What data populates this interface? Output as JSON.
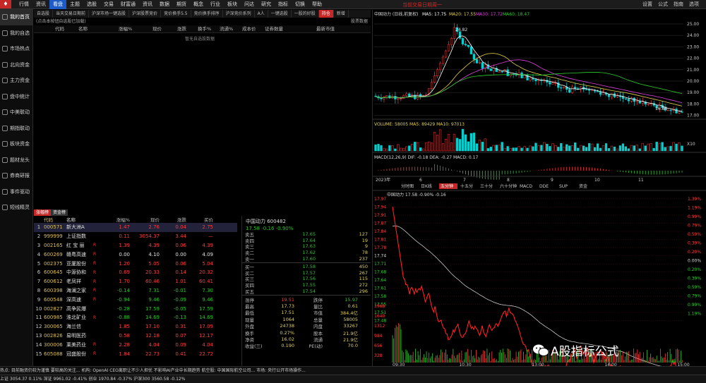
{
  "topbar": {
    "menu": [
      "行情",
      "资讯",
      "看盘",
      "主题",
      "选股",
      "交易",
      "财富通",
      "资讯",
      "数据",
      "期货",
      "概念",
      "行业",
      "板块",
      "问达",
      "研究",
      "指标",
      "切换",
      "帮助"
    ],
    "active_index": 2,
    "center": "当前交易日期周一",
    "right": [
      "设置",
      "公式",
      "指南",
      "选项"
    ]
  },
  "sidebar": {
    "items": [
      "我的首页",
      "我的自选",
      "市场热点",
      "北向资金",
      "主力资金",
      "盘中统计",
      "中美联动",
      "期指联动",
      "板块资金",
      "题材龙头",
      "券商研报",
      "事件驱动",
      "短线精灵"
    ],
    "active_index": 0
  },
  "tabs": [
    "自选股",
    "当天交易日期前",
    "沪深市场一键选股",
    "沪深股票竞价",
    "竞价换手5.5",
    "竞价换手排序",
    "沪深竞价系列",
    "A人",
    "一键选股",
    "一股的好股",
    "持仓",
    "新增"
  ],
  "tabs_active_index": 10,
  "notice": {
    "left": "(点击本按钮自选股已加载)",
    "right": "股票数据"
  },
  "table_header": [
    "代码",
    "名称",
    "涨幅%",
    "现价",
    "涨跌",
    "换手%",
    "流通%",
    "成本价",
    "证券数量",
    "最新市值"
  ],
  "empty_message": "暂无自选股数据",
  "lower_tabs": [
    "涨幅榜",
    "资金榜"
  ],
  "rank_header": [
    "",
    "代码",
    "名称",
    "",
    "涨幅%",
    "现价",
    "涨跌",
    "买价"
  ],
  "rank_rows": [
    {
      "n": "1",
      "code": "000571",
      "name": "新大洲A",
      "flag": "",
      "chg": "1.47",
      "price": "2.76",
      "diff": "0.04",
      "bid": "2.75",
      "dir": "up"
    },
    {
      "n": "2",
      "code": "999999",
      "name": "上证指数",
      "flag": "",
      "chg": "0.11",
      "price": "3054.37",
      "diff": "3.44",
      "bid": "—",
      "dir": "up"
    },
    {
      "n": "3",
      "code": "002165",
      "name": "红 宝 丽",
      "flag": "R",
      "chg": "1.39",
      "price": "4.39",
      "diff": "0.06",
      "bid": "4.39",
      "dir": "up"
    },
    {
      "n": "4",
      "code": "600269",
      "name": "赣粤高速",
      "flag": "R",
      "chg": "0.00",
      "price": "4.10",
      "diff": "0.00",
      "bid": "4.09",
      "dir": "wh"
    },
    {
      "n": "5",
      "code": "002375",
      "name": "亚厦股份",
      "flag": "R",
      "chg": "1.20",
      "price": "5.05",
      "diff": "0.06",
      "bid": "5.04",
      "dir": "up"
    },
    {
      "n": "6",
      "code": "600645",
      "name": "中源协和",
      "flag": "R",
      "chg": "0.69",
      "price": "20.33",
      "diff": "0.14",
      "bid": "20.32",
      "dir": "up"
    },
    {
      "n": "7",
      "code": "600612",
      "name": "老凤祥",
      "flag": "R",
      "chg": "1.70",
      "price": "60.46",
      "diff": "1.01",
      "bid": "60.41",
      "dir": "up"
    },
    {
      "n": "8",
      "code": "600398",
      "name": "海澜之家",
      "flag": "R",
      "chg": "-0.14",
      "price": "7.31",
      "diff": "-0.01",
      "bid": "7.30",
      "dir": "dn"
    },
    {
      "n": "9",
      "code": "600548",
      "name": "深高速",
      "flag": "R",
      "chg": "-0.94",
      "price": "9.46",
      "diff": "-0.09",
      "bid": "9.46",
      "dir": "dn"
    },
    {
      "n": "10",
      "code": "002827",
      "name": "高争民爆",
      "flag": "",
      "chg": "-0.28",
      "price": "17.59",
      "diff": "-0.05",
      "bid": "17.59",
      "dir": "dn"
    },
    {
      "n": "11",
      "code": "600985",
      "name": "淮北矿业",
      "flag": "R",
      "chg": "-0.88",
      "price": "14.69",
      "diff": "-0.13",
      "bid": "14.69",
      "dir": "dn"
    },
    {
      "n": "12",
      "code": "300065",
      "name": "海兰信",
      "flag": "",
      "chg": "1.85",
      "price": "17.10",
      "diff": "0.31",
      "bid": "17.09",
      "dir": "up"
    },
    {
      "n": "13",
      "code": "002826",
      "name": "易明医药",
      "flag": "",
      "chg": "0.58",
      "price": "12.18",
      "diff": "0.07",
      "bid": "12.17",
      "dir": "up"
    },
    {
      "n": "14",
      "code": "300006",
      "name": "莱美药业",
      "flag": "R",
      "chg": "2.28",
      "price": "4.04",
      "diff": "0.09",
      "bid": "4.04",
      "dir": "up"
    },
    {
      "n": "15",
      "code": "605088",
      "name": "冠盛股份",
      "flag": "R",
      "chg": "1.84",
      "price": "22.73",
      "diff": "0.41",
      "bid": "22.72",
      "dir": "up"
    }
  ],
  "quote": {
    "title": "中国动力 600482",
    "price": "17.58",
    "change": "-0.16",
    "pct": "-0.90%",
    "asks": [
      [
        "卖五",
        "17.65",
        "127"
      ],
      [
        "卖四",
        "17.64",
        "19"
      ],
      [
        "卖三",
        "17.63",
        "9"
      ],
      [
        "卖二",
        "17.62",
        "78"
      ],
      [
        "卖一",
        "17.60",
        "237"
      ]
    ],
    "bids": [
      [
        "买一",
        "17.58",
        "450"
      ],
      [
        "买二",
        "17.57",
        "267"
      ],
      [
        "买三",
        "17.56",
        "115"
      ],
      [
        "买四",
        "17.55",
        "272"
      ],
      [
        "买五",
        "17.54",
        "296"
      ]
    ],
    "stats": [
      [
        "涨停",
        "19.51",
        "跌停",
        "15.97"
      ],
      [
        "最高",
        "17.73",
        "量比",
        "0.61"
      ],
      [
        "最低",
        "17.51",
        "市值",
        "384.4亿"
      ],
      [
        "现量",
        "1064",
        "总量",
        "58005"
      ],
      [
        "外盘",
        "24738",
        "内盘",
        "33267"
      ],
      [
        "换手",
        "0.27%",
        "股本",
        "21.9亿"
      ],
      [
        "净资",
        "16.02",
        "流通",
        "21.9亿"
      ],
      [
        "收益(三)",
        "0.190",
        "PE(动)",
        "70.0"
      ]
    ]
  },
  "chart": {
    "title": "中国动力 (日线,前复权)",
    "ma": [
      "MA5: 17.75",
      "MA20: 17.55",
      "MA30: 17.72",
      "MA60: 18.47"
    ],
    "yticks": [
      "25.00",
      "24.00",
      "23.00",
      "22.00",
      "21.00",
      "20.00",
      "19.00",
      "18.00",
      "17.00"
    ],
    "peak_label": "24.82",
    "low_label": "16.86",
    "volume_title": "VOLUME: 58005  MA5: 89429  MA10: 97013",
    "vol_yticks": [
      "X10"
    ],
    "macd_title": "MACD(12,26,9)  DIF: -0.18  DEA: -0.27  MACD: 0.17",
    "xlabels": [
      "2023年",
      "6",
      "7",
      "8",
      "9",
      "10",
      "11"
    ],
    "mode_tabs": [
      "分时图",
      "日K线",
      "五分钟",
      "十五分",
      "三十分",
      "六十分钟",
      "MACD",
      "DDE",
      "SUP",
      "资金"
    ],
    "mode_tabs_active": 2,
    "intraday_title": "中国动力  17.58  -0.90%  -0.16",
    "intraday_left": [
      "17.97",
      "17.94",
      "17.91",
      "17.87",
      "17.84",
      "17.81",
      "17.78",
      "17.74",
      "17.71",
      "17.68",
      "17.64",
      "17.61",
      "17.58",
      "17.55",
      "17.51",
      "17.48"
    ],
    "intraday_right": [
      "1.39%",
      "1.19%",
      "0.99%",
      "0.79%",
      "0.59%",
      "0.39%",
      "0.20%",
      "0.00%",
      "0.20%",
      "0.39%",
      "0.59%",
      "0.79%",
      "0.99%",
      "1.19%"
    ],
    "intraday_vol": [
      "1968",
      "1640",
      "1312",
      "984",
      "656",
      "328"
    ],
    "intraday_x": [
      "09:30",
      "10:30",
      "13:00",
      "14:00",
      "15:00"
    ]
  },
  "bottom": "热点: 目前融资仍较为谨慎 要较高的关注... 机构: OpenAI CEO离职让不少人担忧 不影响AI产业中长期趋势  航空股: 中国国际航空公司... 市场: 央行公开市场操作...",
  "status": "上证 3054.37 0.11%  深证 9961.02 -0.41%  创业 1970.84 -0.37%  沪深300 3560.58  -0.12%",
  "watermark": "A股指标公式"
}
